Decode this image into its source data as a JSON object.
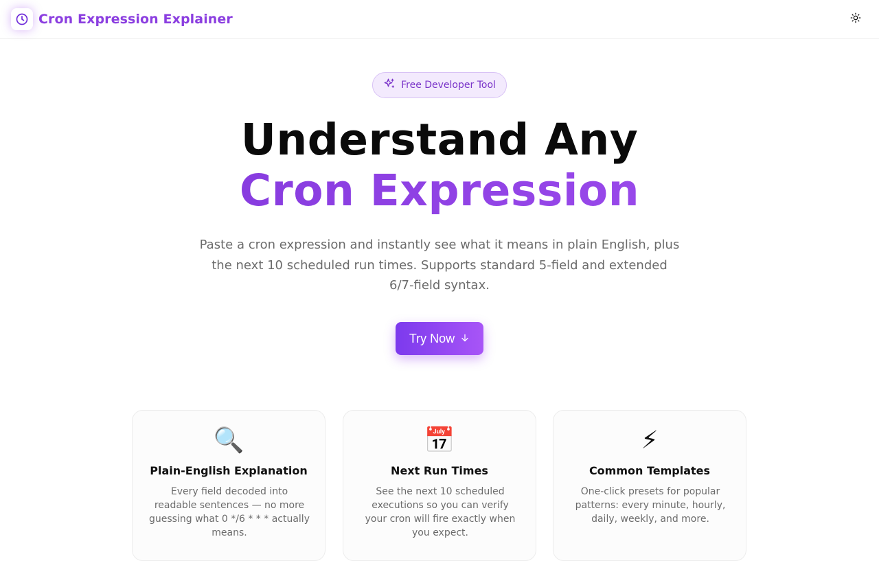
{
  "header": {
    "title": "Cron Expression Explainer",
    "logo_icon": "clock-icon",
    "theme_icon": "sun-icon"
  },
  "hero": {
    "badge": {
      "label": "Free Developer Tool",
      "icon": "sparkles-icon"
    },
    "heading_line1": "Understand Any",
    "heading_line2": "Cron Expression",
    "subtitle": "Paste a cron expression and instantly see what it means in plain English, plus the next 10 scheduled run times. Supports standard 5-field and extended 6/7-field syntax.",
    "cta": {
      "label": "Try Now",
      "icon": "arrow-down-icon"
    }
  },
  "features": [
    {
      "emoji": "🔍",
      "title": "Plain-English Explanation",
      "description": "Every field decoded into readable sentences — no more guessing what 0 */6 * * * actually means."
    },
    {
      "emoji": "📅",
      "title": "Next Run Times",
      "description": "See the next 10 scheduled executions so you can verify your cron will fire exactly when you expect."
    },
    {
      "emoji": "⚡",
      "title": "Common Templates",
      "description": "One-click presets for popular patterns: every minute, hourly, daily, weekly, and more."
    }
  ],
  "colors": {
    "accent": "#9333ea",
    "accent_light": "#f3eafd"
  }
}
